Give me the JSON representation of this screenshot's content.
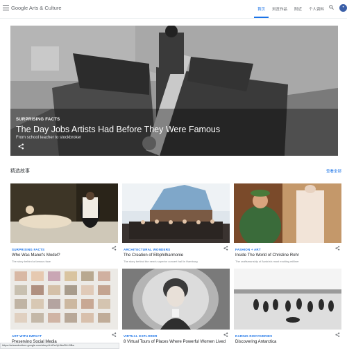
{
  "header": {
    "logo": "Google Arts & Culture",
    "nav": [
      {
        "label": "首页",
        "active": true
      },
      {
        "label": "浏览作品",
        "active": false
      },
      {
        "label": "附近",
        "active": false
      },
      {
        "label": "个人资料",
        "active": false
      }
    ]
  },
  "hero": {
    "eyebrow": "SURPRISING FACTS",
    "title": "The Day Jobs Artists Had Before They Were Famous",
    "subtitle": "From school teacher to stockbroker"
  },
  "section": {
    "title": "精选故事",
    "see_all": "查看全部"
  },
  "cards": [
    {
      "category": "SURPRISING FACTS",
      "title": "Who Was Manet's Model?",
      "description": "The story behind a famous face"
    },
    {
      "category": "ARCHITECTURAL WONDERS",
      "title": "The Creation of Elbphilharmonie",
      "description": "The story behind the new's superior concert hall in Hamburg"
    },
    {
      "category": "FASHION + ART",
      "title": "Inside The World of Christine Rohr",
      "description": "The craftsmanship of Austria's most exciting milliner"
    },
    {
      "category": "ART WITH IMPACT",
      "title": "Preserving Social Media",
      "description": ""
    },
    {
      "category": "VIRTUAL EXPLORER",
      "title": "8 Virtual Tours of Places Where Powerful Women Lived",
      "description": ""
    },
    {
      "category": "DARING DISCOVERIES",
      "title": "Discovering Antarctica",
      "description": ""
    }
  ],
  "status_url": "https://artsandculture.google.com/story/xLkEwJyhNwZtLh3Bw",
  "colors": {
    "accent": "#1a73e8",
    "avatar": "#3b5fa8"
  }
}
